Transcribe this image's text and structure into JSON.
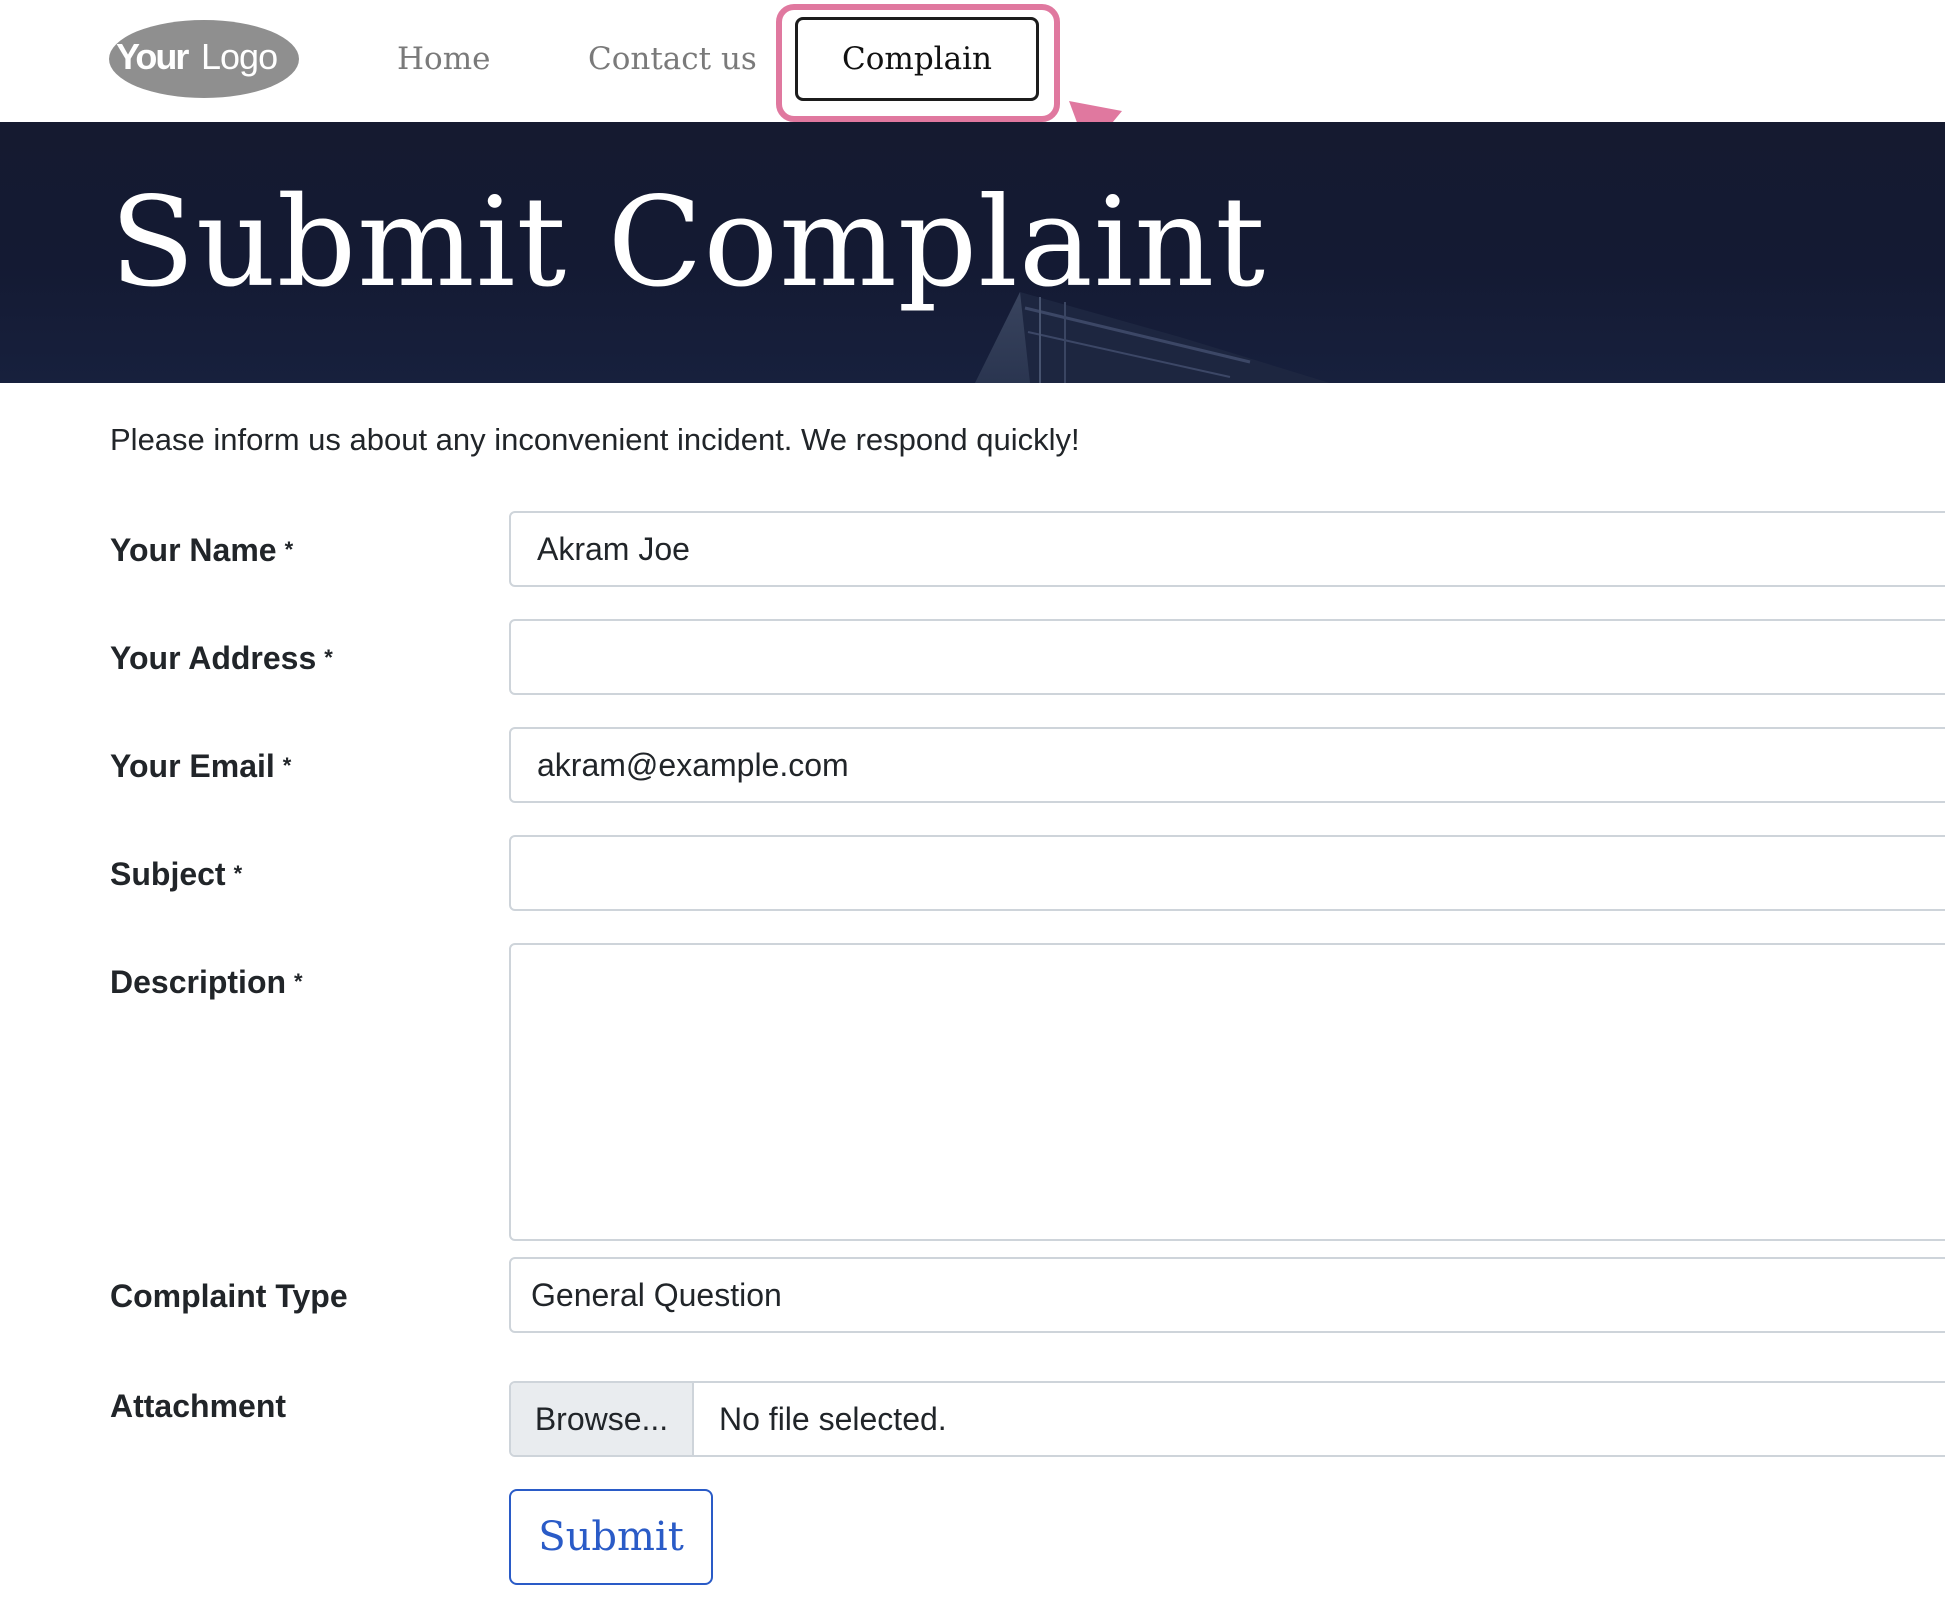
{
  "nav": {
    "logo": "YourLogo",
    "logo_your": "Your",
    "logo_logo": "Logo",
    "items": [
      {
        "label": "Home"
      },
      {
        "label": "Contact us"
      },
      {
        "label": "Complain"
      }
    ],
    "highlight_color": "#e0789f"
  },
  "hero": {
    "title": "Submit Complaint",
    "bg_color": "#141a33"
  },
  "form": {
    "intro": "Please inform us about any inconvenient incident. We respond quickly!",
    "required_mark": "*",
    "fields": {
      "name": {
        "label": "Your Name",
        "value": "Akram Joe"
      },
      "address": {
        "label": "Your Address",
        "value": ""
      },
      "email": {
        "label": "Your Email",
        "value": "akram@example.com"
      },
      "subject": {
        "label": "Subject",
        "value": ""
      },
      "description": {
        "label": "Description",
        "value": ""
      },
      "complaint_type": {
        "label": "Complaint Type",
        "value": "General Question"
      },
      "attachment": {
        "label": "Attachment",
        "browse_label": "Browse...",
        "status": "No file selected."
      }
    },
    "submit_label": "Submit",
    "accent_color": "#2a5bc7"
  }
}
